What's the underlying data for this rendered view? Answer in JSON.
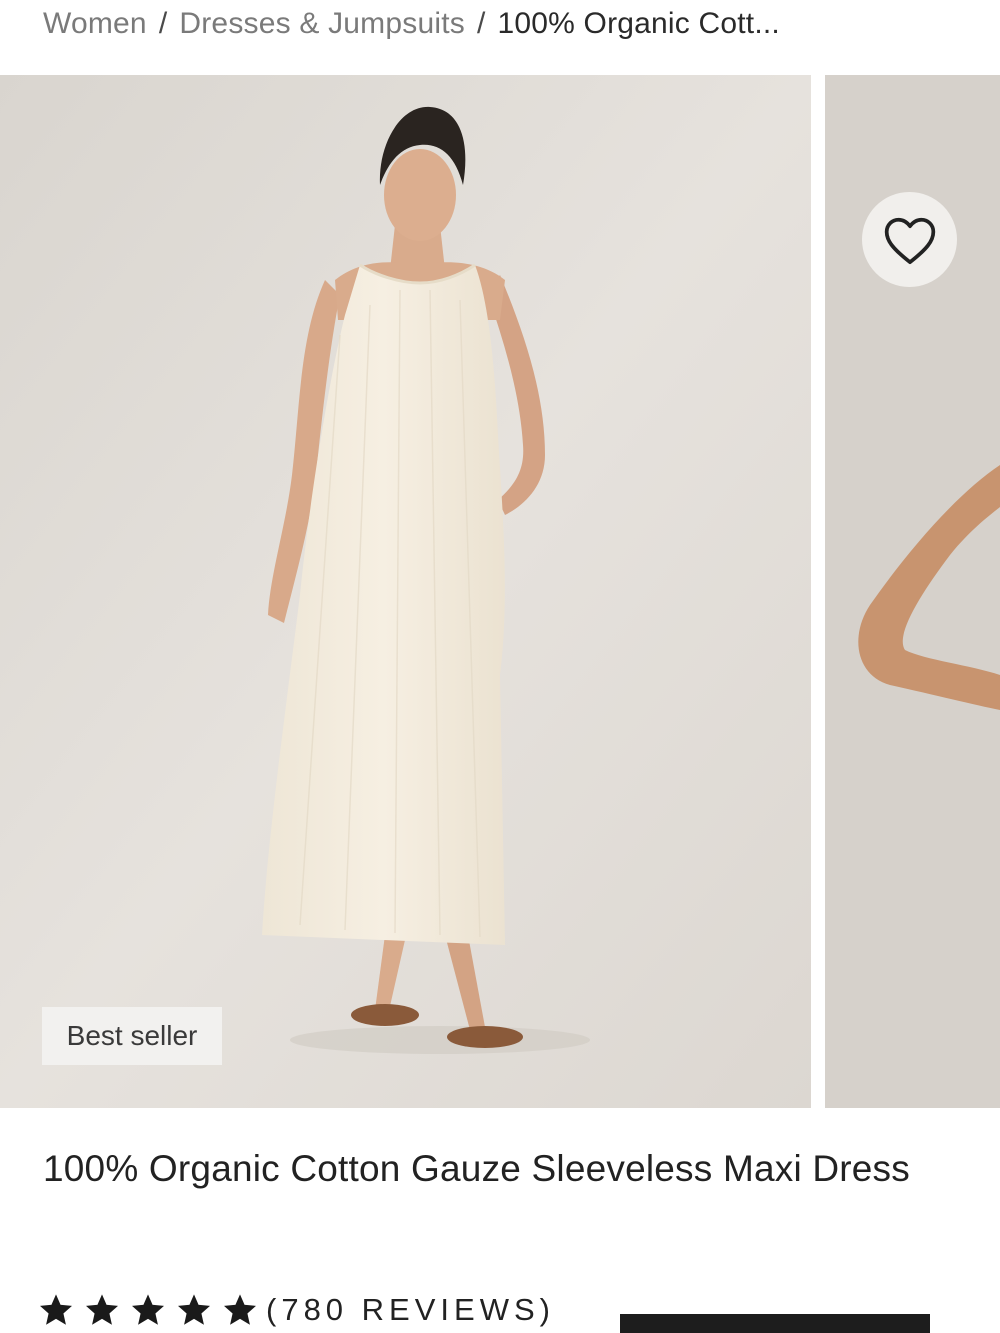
{
  "breadcrumb": {
    "items": [
      "Women",
      "Dresses & Jumpsuits"
    ],
    "separator": "/",
    "current": "100% Organic Cott..."
  },
  "gallery": {
    "badge": "Best seller",
    "wishlist_icon": "heart-outline-icon"
  },
  "product": {
    "title": "100% Organic Cotton Gauze Sleeveless Maxi Dress",
    "rating": 5,
    "rating_max": 5,
    "reviews_label": "(780 REVIEWS)"
  },
  "colors": {
    "background": "#ffffff",
    "photo_bg": "#e2ded9",
    "text": "#222222",
    "muted": "#7a7a7a",
    "star": "#1a1a1a"
  }
}
